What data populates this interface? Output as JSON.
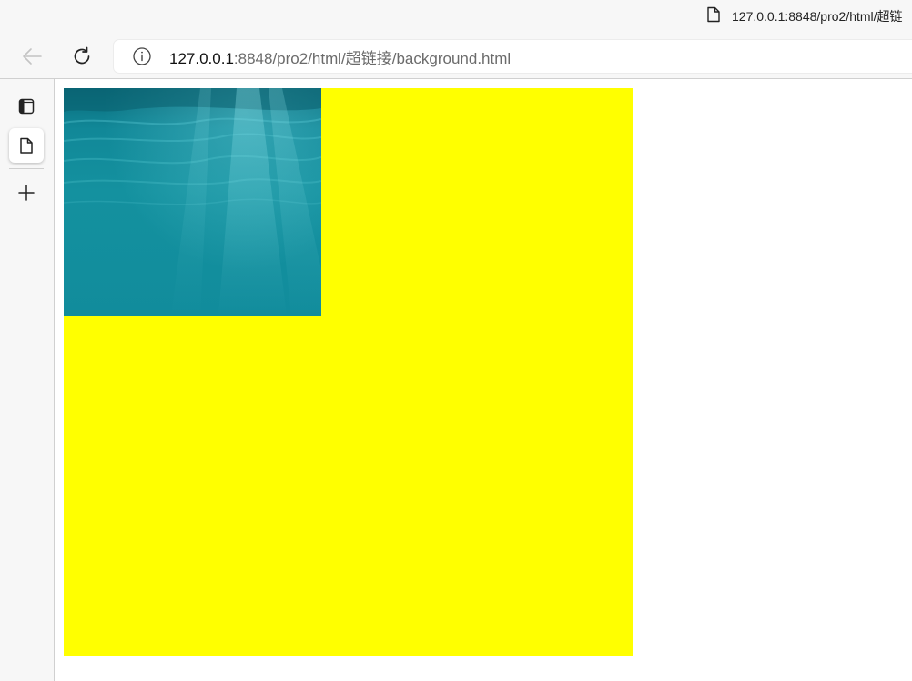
{
  "window": {
    "tab_title": "127.0.0.1:8848/pro2/html/超链"
  },
  "toolbar": {
    "url_host": "127.0.0.1",
    "url_path": ":8848/pro2/html/超链接/background.html"
  },
  "sidebar": {
    "items": [
      {
        "icon": "tab-panel-icon"
      },
      {
        "icon": "page-icon"
      },
      {
        "icon": "plus-icon"
      }
    ]
  },
  "page": {
    "box_color": "#ffff00",
    "image_desc_color": "#118c9c"
  }
}
